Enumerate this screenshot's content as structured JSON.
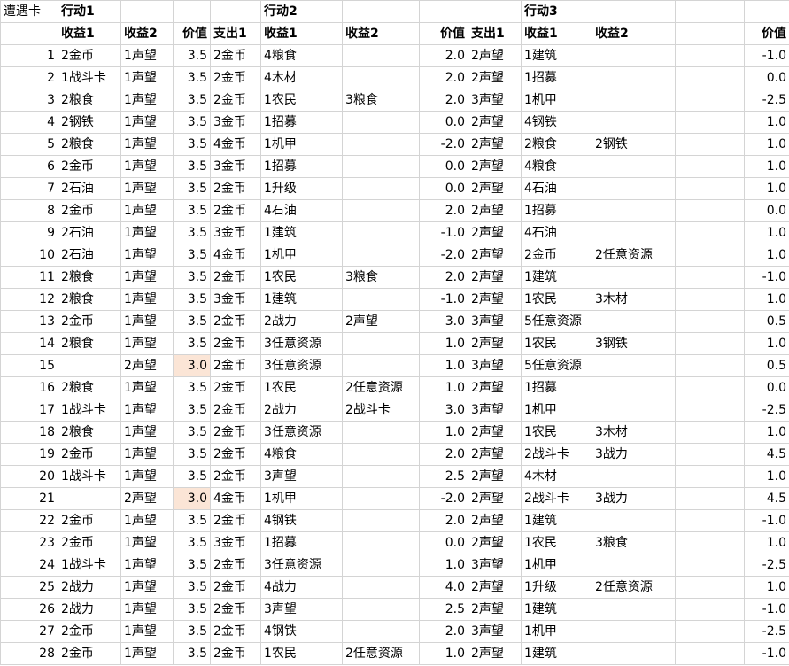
{
  "header": {
    "row1": [
      "遭遇卡",
      "行动1",
      "",
      "",
      "",
      "行动2",
      "",
      "",
      "",
      "行动3",
      "",
      "",
      ""
    ],
    "row2": [
      "",
      "收益1",
      "收益2",
      "价值",
      "支出1",
      "收益1",
      "收益2",
      "价值",
      "支出1",
      "收益1",
      "收益2",
      "",
      "价值"
    ]
  },
  "rows": [
    [
      "1",
      "2金币",
      "1声望",
      "3.5",
      "2金币",
      "4粮食",
      "",
      "2.0",
      "2声望",
      "1建筑",
      "",
      "",
      "-1.0"
    ],
    [
      "2",
      "1战斗卡",
      "1声望",
      "3.5",
      "2金币",
      "4木材",
      "",
      "2.0",
      "2声望",
      "1招募",
      "",
      "",
      "0.0"
    ],
    [
      "3",
      "2粮食",
      "1声望",
      "3.5",
      "2金币",
      "1农民",
      "3粮食",
      "2.0",
      "3声望",
      "1机甲",
      "",
      "",
      "-2.5"
    ],
    [
      "4",
      "2钢铁",
      "1声望",
      "3.5",
      "3金币",
      "1招募",
      "",
      "0.0",
      "2声望",
      "4钢铁",
      "",
      "",
      "1.0"
    ],
    [
      "5",
      "2粮食",
      "1声望",
      "3.5",
      "4金币",
      "1机甲",
      "",
      "-2.0",
      "2声望",
      "2粮食",
      "2钢铁",
      "",
      "1.0"
    ],
    [
      "6",
      "2金币",
      "1声望",
      "3.5",
      "3金币",
      "1招募",
      "",
      "0.0",
      "2声望",
      "4粮食",
      "",
      "",
      "1.0"
    ],
    [
      "7",
      "2石油",
      "1声望",
      "3.5",
      "2金币",
      "1升级",
      "",
      "0.0",
      "2声望",
      "4石油",
      "",
      "",
      "1.0"
    ],
    [
      "8",
      "2金币",
      "1声望",
      "3.5",
      "2金币",
      "4石油",
      "",
      "2.0",
      "2声望",
      "1招募",
      "",
      "",
      "0.0"
    ],
    [
      "9",
      "2石油",
      "1声望",
      "3.5",
      "3金币",
      "1建筑",
      "",
      "-1.0",
      "2声望",
      "4石油",
      "",
      "",
      "1.0"
    ],
    [
      "10",
      "2石油",
      "1声望",
      "3.5",
      "4金币",
      "1机甲",
      "",
      "-2.0",
      "2声望",
      "2金币",
      "2任意资源",
      "",
      "1.0"
    ],
    [
      "11",
      "2粮食",
      "1声望",
      "3.5",
      "2金币",
      "1农民",
      "3粮食",
      "2.0",
      "2声望",
      "1建筑",
      "",
      "",
      "-1.0"
    ],
    [
      "12",
      "2粮食",
      "1声望",
      "3.5",
      "3金币",
      "1建筑",
      "",
      "-1.0",
      "2声望",
      "1农民",
      "3木材",
      "",
      "1.0"
    ],
    [
      "13",
      "2金币",
      "1声望",
      "3.5",
      "2金币",
      "2战力",
      "2声望",
      "3.0",
      "3声望",
      "5任意资源",
      "",
      "",
      "0.5"
    ],
    [
      "14",
      "2粮食",
      "1声望",
      "3.5",
      "2金币",
      "3任意资源",
      "",
      "1.0",
      "2声望",
      "1农民",
      "3钢铁",
      "",
      "1.0"
    ],
    [
      "15",
      "",
      "2声望",
      "3.0",
      "2金币",
      "3任意资源",
      "",
      "1.0",
      "3声望",
      "5任意资源",
      "",
      "",
      "0.5"
    ],
    [
      "16",
      "2粮食",
      "1声望",
      "3.5",
      "2金币",
      "1农民",
      "2任意资源",
      "1.0",
      "2声望",
      "1招募",
      "",
      "",
      "0.0"
    ],
    [
      "17",
      "1战斗卡",
      "1声望",
      "3.5",
      "2金币",
      "2战力",
      "2战斗卡",
      "3.0",
      "3声望",
      "1机甲",
      "",
      "",
      "-2.5"
    ],
    [
      "18",
      "2粮食",
      "1声望",
      "3.5",
      "2金币",
      "3任意资源",
      "",
      "1.0",
      "2声望",
      "1农民",
      "3木材",
      "",
      "1.0"
    ],
    [
      "19",
      "2金币",
      "1声望",
      "3.5",
      "2金币",
      "4粮食",
      "",
      "2.0",
      "2声望",
      "2战斗卡",
      "3战力",
      "",
      "4.5"
    ],
    [
      "20",
      "1战斗卡",
      "1声望",
      "3.5",
      "2金币",
      "3声望",
      "",
      "2.5",
      "2声望",
      "4木材",
      "",
      "",
      "1.0"
    ],
    [
      "21",
      "",
      "2声望",
      "3.0",
      "4金币",
      "1机甲",
      "",
      "-2.0",
      "2声望",
      "2战斗卡",
      "3战力",
      "",
      "4.5"
    ],
    [
      "22",
      "2金币",
      "1声望",
      "3.5",
      "2金币",
      "4钢铁",
      "",
      "2.0",
      "2声望",
      "1建筑",
      "",
      "",
      "-1.0"
    ],
    [
      "23",
      "2金币",
      "1声望",
      "3.5",
      "3金币",
      "1招募",
      "",
      "0.0",
      "2声望",
      "1农民",
      "3粮食",
      "",
      "1.0"
    ],
    [
      "24",
      "1战斗卡",
      "1声望",
      "3.5",
      "2金币",
      "3任意资源",
      "",
      "1.0",
      "3声望",
      "1机甲",
      "",
      "",
      "-2.5"
    ],
    [
      "25",
      "2战力",
      "1声望",
      "3.5",
      "2金币",
      "4战力",
      "",
      "4.0",
      "2声望",
      "1升级",
      "2任意资源",
      "",
      "1.0"
    ],
    [
      "26",
      "2战力",
      "1声望",
      "3.5",
      "2金币",
      "3声望",
      "",
      "2.5",
      "2声望",
      "1建筑",
      "",
      "",
      "-1.0"
    ],
    [
      "27",
      "2金币",
      "1声望",
      "3.5",
      "2金币",
      "4钢铁",
      "",
      "2.0",
      "3声望",
      "1机甲",
      "",
      "",
      "-2.5"
    ],
    [
      "28",
      "2金币",
      "1声望",
      "3.5",
      "2金币",
      "1农民",
      "2任意资源",
      "1.0",
      "2声望",
      "1建筑",
      "",
      "",
      "-1.0"
    ]
  ],
  "highlight_color": "#fbe5d6"
}
